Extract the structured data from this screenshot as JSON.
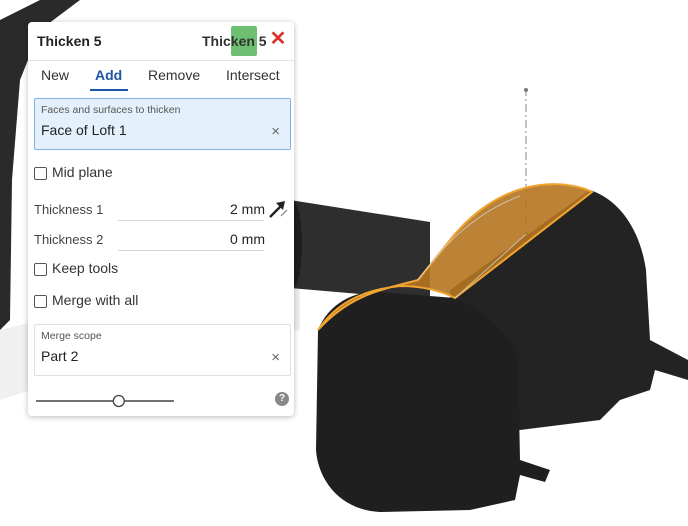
{
  "dialog": {
    "title": "Thicken 5",
    "header_name": "Thicken 5",
    "close_glyph": "✕",
    "tabs": [
      {
        "label": "New"
      },
      {
        "label": "Add"
      },
      {
        "label": "Remove"
      },
      {
        "label": "Intersect"
      }
    ],
    "active_tab": "Add",
    "faces_field": {
      "label": "Faces and surfaces to thicken",
      "value": "Face of Loft 1",
      "clear": "×"
    },
    "mid_plane": {
      "label": "Mid plane",
      "checked": false
    },
    "thickness1": {
      "label": "Thickness 1",
      "value": "2 mm"
    },
    "thickness2": {
      "label": "Thickness 2",
      "value": "0 mm"
    },
    "keep_tools": {
      "label": "Keep tools",
      "checked": false
    },
    "merge_with_all": {
      "label": "Merge with all",
      "checked": false
    },
    "merge_scope": {
      "label": "Merge scope",
      "value": "Part 2",
      "clear": "×"
    },
    "slider_value": 0.6,
    "help_glyph": "?"
  },
  "colors": {
    "selected_face": "#e8a23c",
    "part_body": "#262626",
    "accent": "#1c56a6",
    "ok": "#6fbf73",
    "close": "#d9342b"
  },
  "icons": [
    "close-icon",
    "flip-direction-icon",
    "help-icon",
    "checkbox-icon"
  ]
}
